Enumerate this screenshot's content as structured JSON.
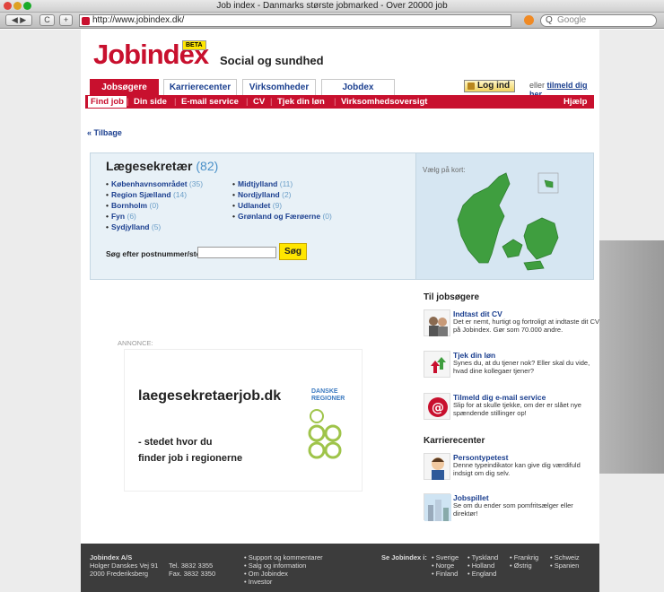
{
  "browser": {
    "title": "Job index - Danmarks største jobmarked - Over 20000 job",
    "url": "http://www.jobindex.dk/",
    "search_placeholder": "Google",
    "reload": "C",
    "add": "+"
  },
  "header": {
    "logo": "Jobindex",
    "beta": "BETA",
    "tagline": "Social og sundhed",
    "tabs": [
      "Jobsøgere",
      "Karrierecenter",
      "Virksomheder",
      "Jobdex"
    ],
    "login_label": "Log ind",
    "login_or": "eller",
    "signup_label": "tilmeld dig her"
  },
  "subnav": {
    "items": [
      "Find job",
      "Din side",
      "E-mail service",
      "CV",
      "Tjek din løn",
      "Virksomhedsoversigt"
    ],
    "help": "Hjælp"
  },
  "back_link": "« Tilbage",
  "category": {
    "title": "Lægesekretær",
    "count": "(82)",
    "regions_left": [
      {
        "name": "Københavnsområdet",
        "count": "(35)"
      },
      {
        "name": "Region Sjælland",
        "count": "(14)"
      },
      {
        "name": "Bornholm",
        "count": "(0)"
      },
      {
        "name": "Fyn",
        "count": "(6)"
      },
      {
        "name": "Sydjylland",
        "count": "(5)"
      }
    ],
    "regions_right": [
      {
        "name": "Midtjylland",
        "count": "(11)"
      },
      {
        "name": "Nordjylland",
        "count": "(2)"
      },
      {
        "name": "Udlandet",
        "count": "(9)"
      },
      {
        "name": "Grønland og Færøerne",
        "count": "(0)"
      }
    ],
    "search_label": "Søg efter postnummer/sted:",
    "search_button": "Søg",
    "map_label": "Vælg på kort:"
  },
  "ad": {
    "annonce": "ANNONCE:",
    "domain": "laegesekretaerjob.dk",
    "line1": "- stedet hvor du",
    "line2": "finder job i regionerne",
    "brand1": "DANSKE",
    "brand2": "REGIONER"
  },
  "sidebar": {
    "section1": "Til jobsøgere",
    "items1": [
      {
        "title": "Indtast dit CV",
        "text": "Det er nemt, hurtigt og fortroligt at indtaste dit CV på Jobindex. Gør som 70.000 andre."
      },
      {
        "title": "Tjek din løn",
        "text": "Synes du, at du tjener nok? Eller skal du vide, hvad dine kollegaer tjener?"
      },
      {
        "title": "Tilmeld dig e-mail service",
        "text": "Slip for at skulle tjekke, om der er slået nye spændende stillinger op!"
      }
    ],
    "section2": "Karrierecenter",
    "items2": [
      {
        "title": "Persontypetest",
        "text": "Denne typeindikator kan give dig værdifuld indsigt om dig selv."
      },
      {
        "title": "Jobspillet",
        "text": "Se om du ender som pomfritsælger eller direktør!"
      }
    ]
  },
  "footer": {
    "company": "Jobindex A/S",
    "address1": "Holger Danskes Vej 91",
    "address2": "2000 Frederiksberg",
    "phone": "Tel. 3832 3355",
    "fax": "Fax. 3832 3350",
    "links": [
      "Support og kommentarer",
      "Salg og information",
      "Om Jobindex",
      "Investor"
    ],
    "see_label": "Se Jobindex i:",
    "countries": [
      "Sverige",
      "Norge",
      "Finland",
      "Tyskland",
      "Holland",
      "England",
      "Frankrig",
      "Østrig",
      "Schweiz",
      "Spanien"
    ]
  }
}
